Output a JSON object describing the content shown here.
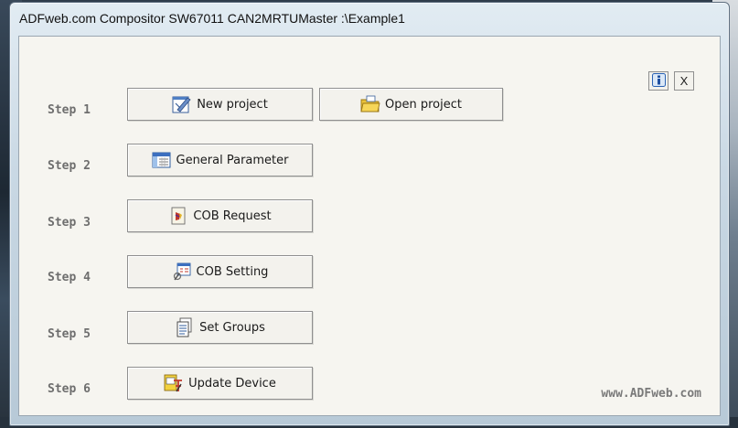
{
  "window": {
    "title": "ADFweb.com Compositor SW67011 CAN2MRTUMaster :\\Example1"
  },
  "toolbar": {
    "info_icon": "info-icon",
    "close_label": "X"
  },
  "steps": [
    {
      "label": "Step 1"
    },
    {
      "label": "Step 2"
    },
    {
      "label": "Step 3"
    },
    {
      "label": "Step 4"
    },
    {
      "label": "Step 5"
    },
    {
      "label": "Step 6"
    }
  ],
  "buttons": {
    "new_project": {
      "label": "New project",
      "icon": "new-project-icon"
    },
    "open_project": {
      "label": "Open project",
      "icon": "folder-icon"
    },
    "general_parameter": {
      "label": "General Parameter",
      "icon": "table-icon"
    },
    "cob_request": {
      "label": "COB Request",
      "icon": "request-icon"
    },
    "cob_setting": {
      "label": "COB Setting",
      "icon": "setting-icon"
    },
    "set_groups": {
      "label": "Set Groups",
      "icon": "document-icon"
    },
    "update_device": {
      "label": "Update Device",
      "icon": "update-device-icon"
    }
  },
  "footer": {
    "url": "www.ADFweb.com"
  }
}
